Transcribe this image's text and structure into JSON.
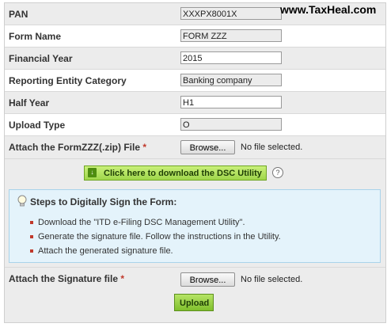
{
  "watermark": "www.TaxHeal.com",
  "form": {
    "pan": {
      "label": "PAN",
      "value": "XXXPX8001X"
    },
    "form_name": {
      "label": "Form Name",
      "value": "FORM ZZZ"
    },
    "financial_year": {
      "label": "Financial Year",
      "value": "2015"
    },
    "reporting_entity": {
      "label": "Reporting Entity Category",
      "value": "Banking company"
    },
    "half_year": {
      "label": "Half Year",
      "value": "H1"
    },
    "upload_type": {
      "label": "Upload Type",
      "value": "O"
    },
    "attach_form": {
      "label": "Attach the FormZZZ(.zip) File",
      "required": "*",
      "browse": "Browse...",
      "status": "No file selected."
    }
  },
  "dsc": {
    "button_label": "Click here to download the DSC Utility",
    "help": "?"
  },
  "steps": {
    "title": "Steps to Digitally Sign the Form:",
    "items": [
      "Download the \"ITD e-Filing DSC Management Utility\".",
      "Generate the signature file. Follow the instructions in the Utility.",
      "Attach the generated signature file."
    ]
  },
  "signature": {
    "label": "Attach the Signature file",
    "required": "*",
    "browse": "Browse...",
    "status": "No file selected."
  },
  "upload": {
    "label": "Upload"
  },
  "colors": {
    "accent_green": "#9fd64b",
    "info_blue": "#e4f3fb",
    "required_red": "#c0392b"
  }
}
